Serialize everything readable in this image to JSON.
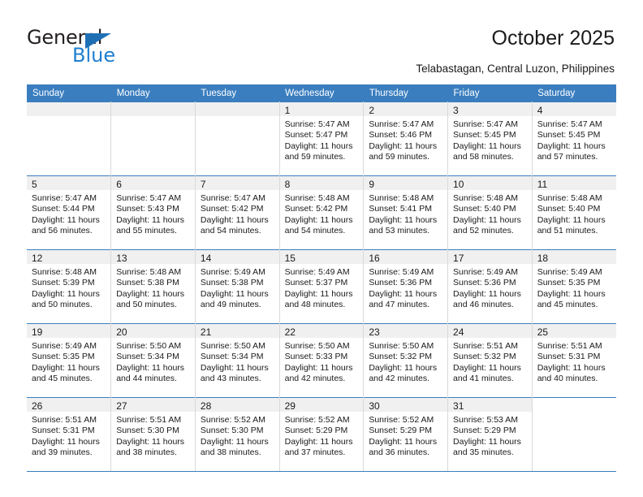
{
  "brand": {
    "name_top": "General",
    "name_bottom": "Blue",
    "triangle_icon": "triangle-icon",
    "color_dark": "#231f20",
    "color_blue": "#1f7fd0"
  },
  "header": {
    "title": "October 2025",
    "subtitle": "Telabastagan, Central Luzon, Philippines"
  },
  "theme": {
    "header_blue": "#3a7ebf",
    "daynum_band": "#f0f0f0",
    "cell_border": "#d9d9d9",
    "text": "#1a1a1a"
  },
  "calendar": {
    "weekday_headers": [
      "Sunday",
      "Monday",
      "Tuesday",
      "Wednesday",
      "Thursday",
      "Friday",
      "Saturday"
    ],
    "weeks": [
      [
        {
          "day": "",
          "lines": []
        },
        {
          "day": "",
          "lines": []
        },
        {
          "day": "",
          "lines": []
        },
        {
          "day": "1",
          "lines": [
            "Sunrise: 5:47 AM",
            "Sunset: 5:47 PM",
            "Daylight: 11 hours",
            "and 59 minutes."
          ]
        },
        {
          "day": "2",
          "lines": [
            "Sunrise: 5:47 AM",
            "Sunset: 5:46 PM",
            "Daylight: 11 hours",
            "and 59 minutes."
          ]
        },
        {
          "day": "3",
          "lines": [
            "Sunrise: 5:47 AM",
            "Sunset: 5:45 PM",
            "Daylight: 11 hours",
            "and 58 minutes."
          ]
        },
        {
          "day": "4",
          "lines": [
            "Sunrise: 5:47 AM",
            "Sunset: 5:45 PM",
            "Daylight: 11 hours",
            "and 57 minutes."
          ]
        }
      ],
      [
        {
          "day": "5",
          "lines": [
            "Sunrise: 5:47 AM",
            "Sunset: 5:44 PM",
            "Daylight: 11 hours",
            "and 56 minutes."
          ]
        },
        {
          "day": "6",
          "lines": [
            "Sunrise: 5:47 AM",
            "Sunset: 5:43 PM",
            "Daylight: 11 hours",
            "and 55 minutes."
          ]
        },
        {
          "day": "7",
          "lines": [
            "Sunrise: 5:47 AM",
            "Sunset: 5:42 PM",
            "Daylight: 11 hours",
            "and 54 minutes."
          ]
        },
        {
          "day": "8",
          "lines": [
            "Sunrise: 5:48 AM",
            "Sunset: 5:42 PM",
            "Daylight: 11 hours",
            "and 54 minutes."
          ]
        },
        {
          "day": "9",
          "lines": [
            "Sunrise: 5:48 AM",
            "Sunset: 5:41 PM",
            "Daylight: 11 hours",
            "and 53 minutes."
          ]
        },
        {
          "day": "10",
          "lines": [
            "Sunrise: 5:48 AM",
            "Sunset: 5:40 PM",
            "Daylight: 11 hours",
            "and 52 minutes."
          ]
        },
        {
          "day": "11",
          "lines": [
            "Sunrise: 5:48 AM",
            "Sunset: 5:40 PM",
            "Daylight: 11 hours",
            "and 51 minutes."
          ]
        }
      ],
      [
        {
          "day": "12",
          "lines": [
            "Sunrise: 5:48 AM",
            "Sunset: 5:39 PM",
            "Daylight: 11 hours",
            "and 50 minutes."
          ]
        },
        {
          "day": "13",
          "lines": [
            "Sunrise: 5:48 AM",
            "Sunset: 5:38 PM",
            "Daylight: 11 hours",
            "and 50 minutes."
          ]
        },
        {
          "day": "14",
          "lines": [
            "Sunrise: 5:49 AM",
            "Sunset: 5:38 PM",
            "Daylight: 11 hours",
            "and 49 minutes."
          ]
        },
        {
          "day": "15",
          "lines": [
            "Sunrise: 5:49 AM",
            "Sunset: 5:37 PM",
            "Daylight: 11 hours",
            "and 48 minutes."
          ]
        },
        {
          "day": "16",
          "lines": [
            "Sunrise: 5:49 AM",
            "Sunset: 5:36 PM",
            "Daylight: 11 hours",
            "and 47 minutes."
          ]
        },
        {
          "day": "17",
          "lines": [
            "Sunrise: 5:49 AM",
            "Sunset: 5:36 PM",
            "Daylight: 11 hours",
            "and 46 minutes."
          ]
        },
        {
          "day": "18",
          "lines": [
            "Sunrise: 5:49 AM",
            "Sunset: 5:35 PM",
            "Daylight: 11 hours",
            "and 45 minutes."
          ]
        }
      ],
      [
        {
          "day": "19",
          "lines": [
            "Sunrise: 5:49 AM",
            "Sunset: 5:35 PM",
            "Daylight: 11 hours",
            "and 45 minutes."
          ]
        },
        {
          "day": "20",
          "lines": [
            "Sunrise: 5:50 AM",
            "Sunset: 5:34 PM",
            "Daylight: 11 hours",
            "and 44 minutes."
          ]
        },
        {
          "day": "21",
          "lines": [
            "Sunrise: 5:50 AM",
            "Sunset: 5:34 PM",
            "Daylight: 11 hours",
            "and 43 minutes."
          ]
        },
        {
          "day": "22",
          "lines": [
            "Sunrise: 5:50 AM",
            "Sunset: 5:33 PM",
            "Daylight: 11 hours",
            "and 42 minutes."
          ]
        },
        {
          "day": "23",
          "lines": [
            "Sunrise: 5:50 AM",
            "Sunset: 5:32 PM",
            "Daylight: 11 hours",
            "and 42 minutes."
          ]
        },
        {
          "day": "24",
          "lines": [
            "Sunrise: 5:51 AM",
            "Sunset: 5:32 PM",
            "Daylight: 11 hours",
            "and 41 minutes."
          ]
        },
        {
          "day": "25",
          "lines": [
            "Sunrise: 5:51 AM",
            "Sunset: 5:31 PM",
            "Daylight: 11 hours",
            "and 40 minutes."
          ]
        }
      ],
      [
        {
          "day": "26",
          "lines": [
            "Sunrise: 5:51 AM",
            "Sunset: 5:31 PM",
            "Daylight: 11 hours",
            "and 39 minutes."
          ]
        },
        {
          "day": "27",
          "lines": [
            "Sunrise: 5:51 AM",
            "Sunset: 5:30 PM",
            "Daylight: 11 hours",
            "and 38 minutes."
          ]
        },
        {
          "day": "28",
          "lines": [
            "Sunrise: 5:52 AM",
            "Sunset: 5:30 PM",
            "Daylight: 11 hours",
            "and 38 minutes."
          ]
        },
        {
          "day": "29",
          "lines": [
            "Sunrise: 5:52 AM",
            "Sunset: 5:29 PM",
            "Daylight: 11 hours",
            "and 37 minutes."
          ]
        },
        {
          "day": "30",
          "lines": [
            "Sunrise: 5:52 AM",
            "Sunset: 5:29 PM",
            "Daylight: 11 hours",
            "and 36 minutes."
          ]
        },
        {
          "day": "31",
          "lines": [
            "Sunrise: 5:53 AM",
            "Sunset: 5:29 PM",
            "Daylight: 11 hours",
            "and 35 minutes."
          ]
        }
      ]
    ]
  }
}
